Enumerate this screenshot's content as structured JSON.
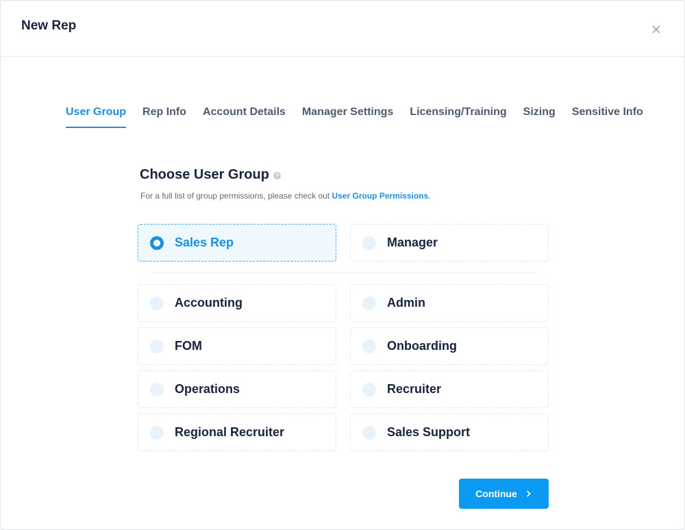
{
  "modal": {
    "title": "New Rep"
  },
  "tabs": [
    {
      "label": "User Group",
      "active": true
    },
    {
      "label": "Rep Info"
    },
    {
      "label": "Account Details"
    },
    {
      "label": "Manager Settings"
    },
    {
      "label": "Licensing/Training"
    },
    {
      "label": "Sizing"
    },
    {
      "label": "Sensitive Info"
    }
  ],
  "section": {
    "title": "Choose User Group",
    "help_icon": "?",
    "subtitle_prefix": "For a full list of group permissions, please check out ",
    "subtitle_link": "User Group Permissions",
    "subtitle_suffix": "."
  },
  "options": {
    "sales_rep": "Sales Rep",
    "manager": "Manager",
    "accounting": "Accounting",
    "admin": "Admin",
    "fom": "FOM",
    "onboarding": "Onboarding",
    "operations": "Operations",
    "recruiter": "Recruiter",
    "regional_recruiter": "Regional Recruiter",
    "sales_support": "Sales Support"
  },
  "selected_option": "Sales Rep",
  "footer": {
    "continue_label": "Continue"
  },
  "colors": {
    "accent": "#1a8fe0",
    "button": "#0a9af2",
    "text": "#16233b"
  }
}
